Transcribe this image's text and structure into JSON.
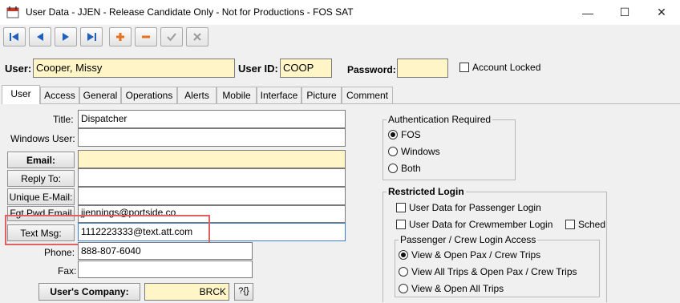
{
  "window": {
    "title": "User Data - JJEN - Release Candidate Only - Not for Productions - FOS SAT",
    "minimize_glyph": "—",
    "maximize_glyph": "☐",
    "close_glyph": "✕"
  },
  "toolbar": {
    "buttons": [
      {
        "name": "first-record-button",
        "glyph": "⏮"
      },
      {
        "name": "prev-record-button",
        "glyph": "◀"
      },
      {
        "name": "next-record-button",
        "glyph": "▶"
      },
      {
        "name": "last-record-button",
        "glyph": "⏭"
      },
      {
        "name": "add-record-button",
        "glyph": "✚"
      },
      {
        "name": "delete-record-button",
        "glyph": "▬"
      },
      {
        "name": "post-button",
        "glyph": "✔"
      },
      {
        "name": "cancel-button",
        "glyph": "✖"
      }
    ]
  },
  "header": {
    "user_label": "User:",
    "user_value": "Cooper, Missy",
    "user_id_label": "User ID:",
    "user_id_value": "COOP",
    "password_label": "Password:",
    "password_value": "",
    "account_locked_label": "Account Locked",
    "account_locked_checked": false
  },
  "tabs": [
    "User",
    "Access",
    "General",
    "Operations",
    "Alerts",
    "Mobile",
    "Interface",
    "Picture",
    "Comment"
  ],
  "active_tab": "User",
  "user_tab": {
    "title_label": "Title:",
    "title_value": "Dispatcher",
    "windows_user_label": "Windows User:",
    "windows_user_value": "",
    "email_button": "Email:",
    "email_value": "",
    "reply_to_button": "Reply To:",
    "reply_to_value": "",
    "unique_email_button": "Unique E-Mail:",
    "unique_email_value": "",
    "fgt_pwd_email_button": "Fgt Pwd Email",
    "fgt_pwd_email_value": "jjennings@portside.co",
    "text_msg_button": "Text Msg:",
    "text_msg_value": "1112223333@text.att.com",
    "phone_label": "Phone:",
    "phone_value": "888-807-6040",
    "fax_label": "Fax:",
    "fax_value": "",
    "company_button": "User's Company:",
    "company_value": "BRCK",
    "company_lookup": "?{}"
  },
  "auth": {
    "title": "Authentication Required",
    "options": [
      "FOS",
      "Windows",
      "Both"
    ],
    "selected": "FOS"
  },
  "restricted": {
    "title": "Restricted Login",
    "passenger_label": "User Data for Passenger Login",
    "crew_label": "User Data for Crewmember Login",
    "sched_label": "Sched",
    "access_title": "Passenger / Crew Login Access",
    "access_options": [
      "View & Open Pax / Crew Trips",
      "View All Trips & Open Pax / Crew Trips",
      "View & Open All Trips"
    ],
    "access_selected": "View & Open Pax / Crew Trips"
  },
  "colors": {
    "field_yellow": "#fff5c6",
    "highlight_red": "#e06060",
    "nav_blue": "#1f5fbf",
    "add_orange": "#e8701a"
  }
}
